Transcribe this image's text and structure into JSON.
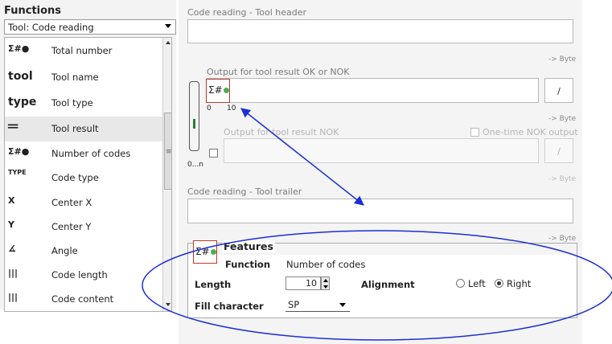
{
  "left_panel": {
    "title": "Functions",
    "tool_select": "Tool: Code reading",
    "items": [
      {
        "icon": "Σ#●",
        "label": "Total number",
        "icon_name": "total-number-icon"
      },
      {
        "icon": "tool",
        "label": "Tool name",
        "icon_name": "tool-name-icon"
      },
      {
        "icon": "type",
        "label": "Tool type",
        "icon_name": "tool-type-icon"
      },
      {
        "icon": "═",
        "label": "Tool result",
        "icon_name": "tool-result-icon"
      },
      {
        "icon": "Σ#●",
        "label": "Number of codes",
        "icon_name": "number-of-codes-icon"
      },
      {
        "icon": "TYPE",
        "label": "Code type",
        "icon_name": "code-type-icon"
      },
      {
        "icon": "X",
        "label": "Center X",
        "icon_name": "center-x-icon"
      },
      {
        "icon": "Y",
        "label": "Center Y",
        "icon_name": "center-y-icon"
      },
      {
        "icon": "∡",
        "label": "Angle",
        "icon_name": "angle-icon"
      },
      {
        "icon": "|||",
        "label": "Code length",
        "icon_name": "code-length-icon"
      },
      {
        "icon": "|||",
        "label": "Code content",
        "icon_name": "code-content-icon"
      }
    ]
  },
  "right_panel": {
    "header_label": "Code reading - Tool header",
    "byte": "-> Byte",
    "output_ok_label": "Output for tool result OK or NOK",
    "slash": "/",
    "range_0": "0",
    "range_10": "10",
    "output_nok_label": "Output for tool result NOK",
    "one_time_label": "One-time NOK output",
    "range_0n": "0...n",
    "trailer_label": "Code reading - Tool trailer"
  },
  "features": {
    "title": "Features",
    "function_label": "Function",
    "function_value": "Number of codes",
    "length_label": "Length",
    "length_value": "10",
    "alignment_label": "Alignment",
    "align_left": "Left",
    "align_right": "Right",
    "alignment_selected": "Right",
    "fill_label": "Fill character",
    "fill_value": "SP"
  },
  "colors": {
    "annotation": "#1a2fd6",
    "icon_border": "#c0392b",
    "dot": "#4caf50"
  }
}
